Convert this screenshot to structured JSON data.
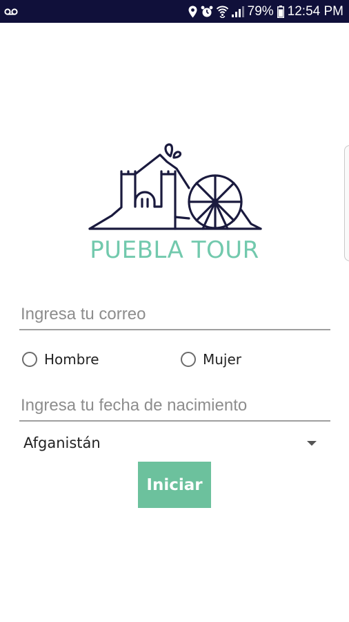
{
  "status_bar": {
    "battery_percent": "79%",
    "time": "12:54 PM",
    "icons": [
      "voicemail-icon",
      "location-icon",
      "alarm-icon",
      "wifi-icon",
      "signal-icon",
      "battery-icon"
    ]
  },
  "logo": {
    "brand_name": "PUEBLA TOUR",
    "brand_color": "#72c9ad",
    "line_color": "#1a1a3e"
  },
  "form": {
    "email_placeholder": "Ingresa tu correo",
    "email_value": "",
    "gender_options": [
      "Hombre",
      "Mujer"
    ],
    "birthdate_placeholder": "Ingresa tu fecha de nacimiento",
    "birthdate_value": "",
    "country_selected": "Afganistán",
    "submit_label": "Iniciar"
  },
  "colors": {
    "status_bar_bg": "#10103a",
    "button_bg": "#6cc19d",
    "button_text": "#ffffff"
  }
}
